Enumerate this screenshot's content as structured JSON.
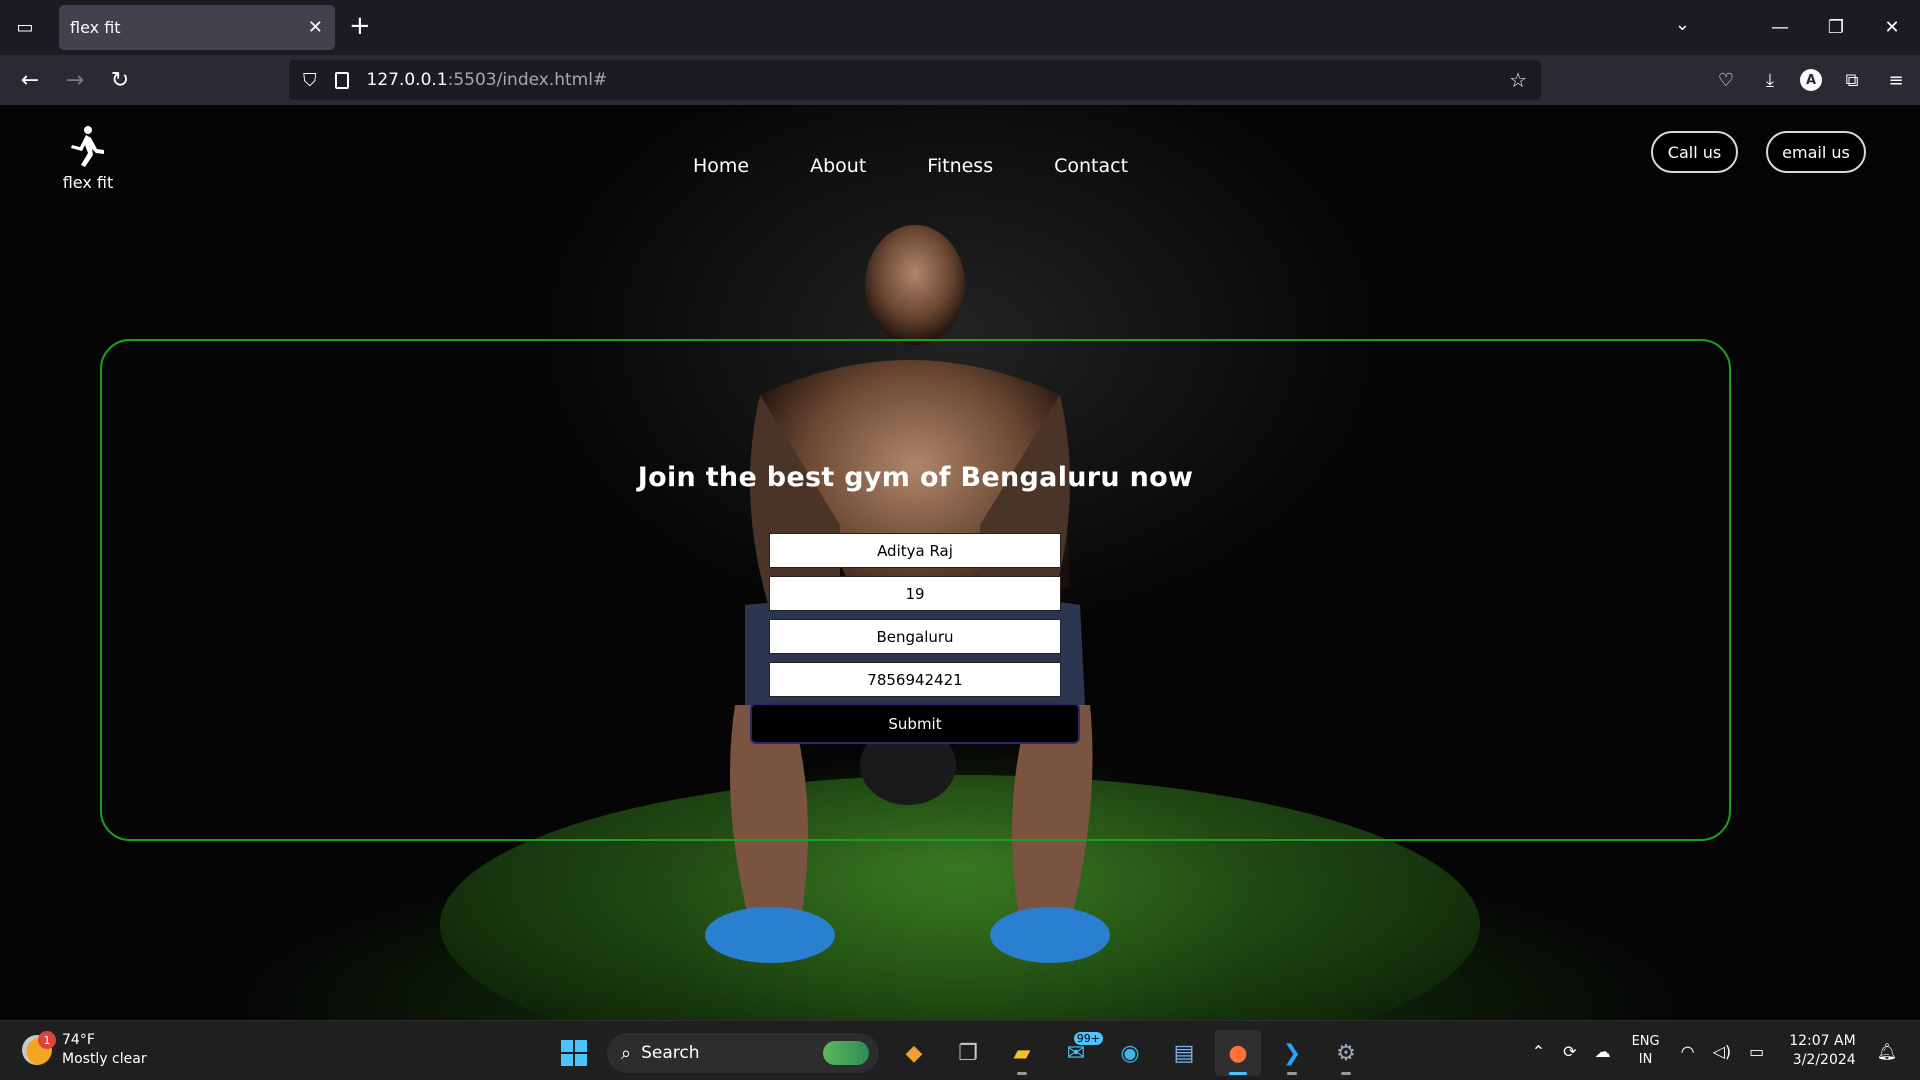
{
  "browser": {
    "tab_title": "flex fit",
    "url_host": "127.0.0.1",
    "url_rest": ":5503/index.html#"
  },
  "site": {
    "brand_name": "flex fit",
    "nav": [
      "Home",
      "About",
      "Fitness",
      "Contact"
    ],
    "call_label": "Call us",
    "email_label": "email us",
    "headline": "Join the best gym of Bengaluru now",
    "form": {
      "name": "Aditya Raj",
      "age": "19",
      "city": "Bengaluru",
      "phone": "7856942421",
      "submit_label": "Submit"
    },
    "colors": {
      "panel_border": "#1aa01a",
      "background": "#000000"
    }
  },
  "taskbar": {
    "weather_badge": "1",
    "temperature": "74°F",
    "condition": "Mostly clear",
    "search_label": "Search",
    "mail_count": "99+",
    "lang_line1": "ENG",
    "lang_line2": "IN",
    "time": "12:07 AM",
    "date": "3/2/2024"
  }
}
